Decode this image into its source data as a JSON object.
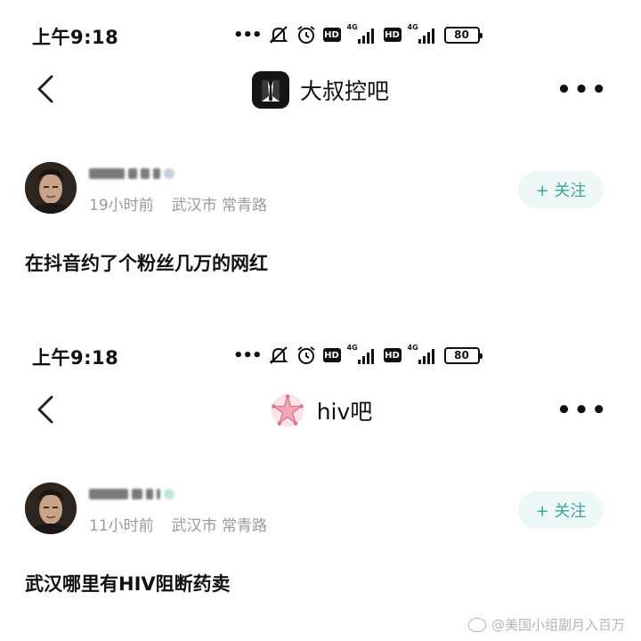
{
  "screens": [
    {
      "status_bar": {
        "time": "上午9:18",
        "hd1": "HD",
        "net1": "4G",
        "hd2": "HD",
        "net2": "4G",
        "battery": "80"
      },
      "nav": {
        "forum_name": "大叔控吧",
        "forum_icon": "suit-icon"
      },
      "post": {
        "time_ago": "19小时前",
        "location": "武汉市 常青路",
        "follow_label": "+ 关注",
        "content": "在抖音约了个粉丝几万的网红"
      }
    },
    {
      "status_bar": {
        "time": "上午9:18",
        "hd1": "HD",
        "net1": "4G",
        "hd2": "HD",
        "net2": "4G",
        "battery": "80"
      },
      "nav": {
        "forum_name": "hiv吧",
        "forum_icon": "pink-star-icon"
      },
      "post": {
        "time_ago": "11小时前",
        "location": "武汉市 常青路",
        "follow_label": "+ 关注",
        "content": "武汉哪里有HIV阻断药卖"
      }
    }
  ],
  "watermark": {
    "text": "@美国小组副月入百万"
  },
  "colors": {
    "follow_bg": "#eef8f6",
    "follow_text": "#3aa89a",
    "meta_text": "#9a9a9a"
  }
}
